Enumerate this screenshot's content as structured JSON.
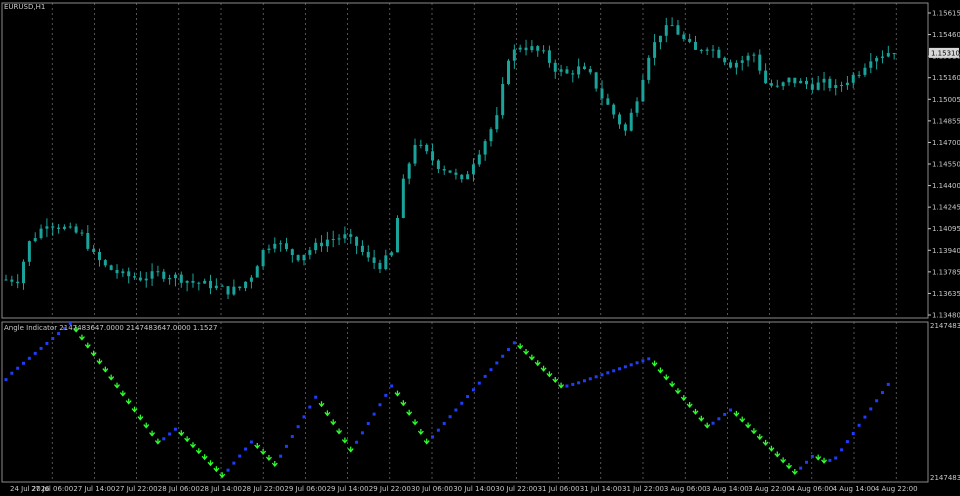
{
  "chart_data": {
    "type": "candlestick",
    "symbol_label": "EURUSD,H1",
    "colors": {
      "candle": "#1aa39a",
      "grid": "#8a8a8a",
      "axis": "#c8c8c8",
      "ind_up": "#1f3cff",
      "ind_down": "#2cff2c",
      "bg": "#000000"
    },
    "price_axis": {
      "ylim": [
        1.1345,
        1.1566
      ],
      "ticks": [
        "1.15615",
        "1.15460",
        "1.15310",
        "1.15160",
        "1.15005",
        "1.14855",
        "1.14700",
        "1.14550",
        "1.14400",
        "1.14245",
        "1.14095",
        "1.13940",
        "1.13785",
        "1.13635",
        "1.13480"
      ],
      "current_price": "1.15310"
    },
    "time_axis": {
      "ticks": [
        "24 Jul 2026",
        "27 Jul 06:00",
        "27 Jul 14:00",
        "27 Jul 22:00",
        "28 Jul 06:00",
        "28 Jul 14:00",
        "28 Jul 22:00",
        "29 Jul 06:00",
        "29 Jul 14:00",
        "29 Jul 22:00",
        "30 Jul 06:00",
        "30 Jul 14:00",
        "30 Jul 22:00",
        "31 Jul 06:00",
        "31 Jul 14:00",
        "31 Jul 22:00",
        "3 Aug 06:00",
        "3 Aug 14:00",
        "3 Aug 22:00",
        "4 Aug 06:00",
        "4 Aug 14:00",
        "4 Aug 22:00"
      ]
    },
    "close_path": [
      [
        0,
        1.1372
      ],
      [
        2,
        1.1372
      ],
      [
        4,
        1.1398
      ],
      [
        7,
        1.1412
      ],
      [
        10,
        1.1408
      ],
      [
        13,
        1.1403
      ],
      [
        15,
        1.1389
      ],
      [
        17,
        1.1381
      ],
      [
        20,
        1.1375
      ],
      [
        23,
        1.1373
      ],
      [
        26,
        1.1376
      ],
      [
        29,
        1.1374
      ],
      [
        32,
        1.137
      ],
      [
        35,
        1.1368
      ],
      [
        38,
        1.1364
      ],
      [
        40,
        1.1366
      ],
      [
        42,
        1.1375
      ],
      [
        44,
        1.1392
      ],
      [
        46,
        1.14
      ],
      [
        48,
        1.1392
      ],
      [
        50,
        1.1388
      ],
      [
        52,
        1.1393
      ],
      [
        55,
        1.14
      ],
      [
        58,
        1.1402
      ],
      [
        60,
        1.1396
      ],
      [
        62,
        1.1386
      ],
      [
        64,
        1.1382
      ],
      [
        66,
        1.139
      ],
      [
        68,
        1.144
      ],
      [
        70,
        1.1468
      ],
      [
        72,
        1.146
      ],
      [
        74,
        1.1452
      ],
      [
        76,
        1.1448
      ],
      [
        78,
        1.144
      ],
      [
        80,
        1.1455
      ],
      [
        82,
        1.147
      ],
      [
        84,
        1.1485
      ],
      [
        86,
        1.1528
      ],
      [
        88,
        1.1536
      ],
      [
        90,
        1.1534
      ],
      [
        92,
        1.153
      ],
      [
        94,
        1.152
      ],
      [
        96,
        1.1516
      ],
      [
        98,
        1.152
      ],
      [
        100,
        1.1515
      ],
      [
        102,
        1.15
      ],
      [
        104,
        1.1488
      ],
      [
        106,
        1.1476
      ],
      [
        108,
        1.15
      ],
      [
        110,
        1.153
      ],
      [
        112,
        1.1545
      ],
      [
        114,
        1.155
      ],
      [
        116,
        1.154
      ],
      [
        118,
        1.1532
      ],
      [
        120,
        1.1536
      ],
      [
        122,
        1.153
      ],
      [
        124,
        1.1523
      ],
      [
        126,
        1.1526
      ],
      [
        128,
        1.153
      ],
      [
        130,
        1.151
      ],
      [
        132,
        1.1506
      ],
      [
        134,
        1.1512
      ],
      [
        136,
        1.151
      ],
      [
        138,
        1.1508
      ],
      [
        140,
        1.151
      ],
      [
        142,
        1.1506
      ],
      [
        144,
        1.1512
      ],
      [
        146,
        1.1518
      ],
      [
        148,
        1.1528
      ],
      [
        150,
        1.153
      ],
      [
        152,
        1.1533
      ]
    ],
    "indicator": {
      "label": "Angle Indicator 2147483647.0000 2147483647.0000 1.1527",
      "y_max_label": "2147483647",
      "y_min_label": "2147483647",
      "pivots": [
        [
          0,
          0.64
        ],
        [
          1,
          0.68
        ],
        [
          11,
          0.99
        ],
        [
          26,
          0.24
        ],
        [
          29,
          0.33
        ],
        [
          37,
          0.03
        ],
        [
          42,
          0.25
        ],
        [
          46,
          0.1
        ],
        [
          53,
          0.53
        ],
        [
          59,
          0.19
        ],
        [
          66,
          0.6
        ],
        [
          72,
          0.24
        ],
        [
          87,
          0.87
        ],
        [
          95,
          0.59
        ],
        [
          98,
          0.62
        ],
        [
          110,
          0.77
        ],
        [
          120,
          0.34
        ],
        [
          124,
          0.45
        ],
        [
          135,
          0.05
        ],
        [
          138,
          0.16
        ],
        [
          140,
          0.12
        ],
        [
          142,
          0.15
        ],
        [
          151,
          0.61
        ]
      ]
    }
  }
}
